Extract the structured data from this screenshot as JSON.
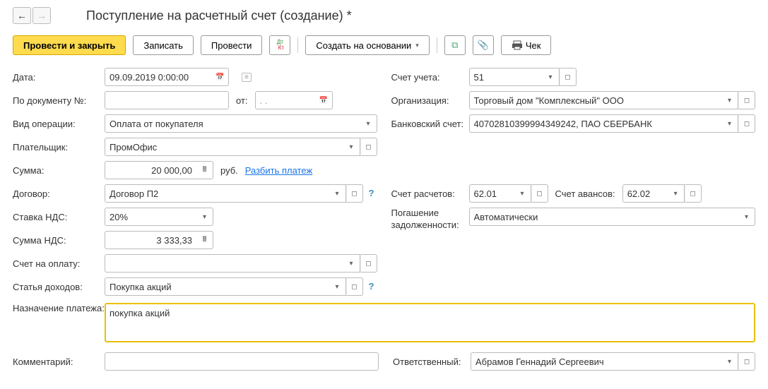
{
  "title": "Поступление на расчетный счет (создание) *",
  "toolbar": {
    "post_close": "Провести и закрыть",
    "save": "Записать",
    "post": "Провести",
    "create_based": "Создать на основании",
    "cheque": "Чек"
  },
  "left": {
    "date_label": "Дата:",
    "date_value": "09.09.2019  0:00:00",
    "docno_label": "По документу №:",
    "docno_value": "",
    "docno_from": "от:",
    "docno_date": "  .    .    ",
    "op_label": "Вид операции:",
    "op_value": "Оплата от покупателя",
    "payer_label": "Плательщик:",
    "payer_value": "ПромОфис",
    "sum_label": "Сумма:",
    "sum_value": "20 000,00",
    "sum_unit": "руб.",
    "split": "Разбить платеж",
    "contract_label": "Договор:",
    "contract_value": "Договор П2",
    "vat_label": "Ставка НДС:",
    "vat_value": "20%",
    "vatsum_label": "Сумма НДС:",
    "vatsum_value": "3 333,33",
    "invoice_label": "Счет на оплату:",
    "invoice_value": "",
    "income_label": "Статья доходов:",
    "income_value": "Покупка акций",
    "purpose_label": "Назначение платежа:",
    "purpose_value": "покупка акций",
    "comment_label": "Комментарий:",
    "comment_value": ""
  },
  "right": {
    "acct_label": "Счет учета:",
    "acct_value": "51",
    "org_label": "Организация:",
    "org_value": "Торговый дом \"Комплексный\" ООО",
    "bank_label": "Банковский счет:",
    "bank_value": "40702810399994349242, ПАО СБЕРБАНК",
    "set_label": "Счет расчетов:",
    "set_value": "62.01",
    "adv_label": "Счет авансов:",
    "adv_value": "62.02",
    "debt_label": "Погашение задолженности:",
    "debt_value": "Автоматически",
    "resp_label": "Ответственный:",
    "resp_value": "Абрамов Геннадий Сергеевич"
  }
}
